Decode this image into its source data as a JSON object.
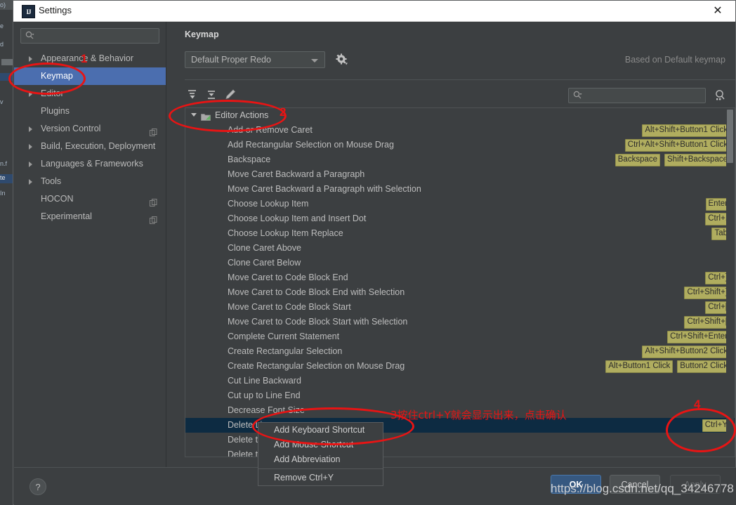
{
  "window": {
    "title": "Settings",
    "app_icon": "intellij-idea-icon",
    "close_label": "✕"
  },
  "sidebar": {
    "search": {
      "placeholder": "",
      "icon": "search-icon"
    },
    "items": [
      {
        "label": "Appearance & Behavior",
        "expandable": true,
        "selected": false,
        "badge": false
      },
      {
        "label": "Keymap",
        "expandable": false,
        "selected": true,
        "badge": false
      },
      {
        "label": "Editor",
        "expandable": true,
        "selected": false,
        "badge": false
      },
      {
        "label": "Plugins",
        "expandable": false,
        "selected": false,
        "badge": false
      },
      {
        "label": "Version Control",
        "expandable": true,
        "selected": false,
        "badge": true
      },
      {
        "label": "Build, Execution, Deployment",
        "expandable": true,
        "selected": false,
        "badge": false
      },
      {
        "label": "Languages & Frameworks",
        "expandable": true,
        "selected": false,
        "badge": false
      },
      {
        "label": "Tools",
        "expandable": true,
        "selected": false,
        "badge": false
      },
      {
        "label": "HOCON",
        "expandable": false,
        "selected": false,
        "badge": true
      },
      {
        "label": "Experimental",
        "expandable": false,
        "selected": false,
        "badge": true
      }
    ]
  },
  "panel": {
    "title": "Keymap",
    "keymap_selected": "Default Proper Redo",
    "gear_icon": "gear-icon",
    "based_on": "Based on Default keymap",
    "toolbar": {
      "expand_all_icon": "expand-all-icon",
      "collapse_all_icon": "collapse-all-icon",
      "edit_icon": "edit-pencil-icon",
      "search_placeholder": "",
      "search_icon": "search-icon",
      "find_shortcut_icon": "find-by-shortcut-icon"
    }
  },
  "action_tree": {
    "group": {
      "label": "Editor Actions",
      "icon": "folder-editor-icon",
      "expanded": true
    },
    "rows": [
      {
        "label": "Add or Remove Caret",
        "shortcuts": [
          "Alt+Shift+Button1 Click"
        ],
        "selected": false
      },
      {
        "label": "Add Rectangular Selection on Mouse Drag",
        "shortcuts": [
          "Ctrl+Alt+Shift+Button1 Click"
        ],
        "selected": false
      },
      {
        "label": "Backspace",
        "shortcuts": [
          "Backspace",
          "Shift+Backspace"
        ],
        "selected": false
      },
      {
        "label": "Move Caret Backward a Paragraph",
        "shortcuts": [],
        "selected": false
      },
      {
        "label": "Move Caret Backward a Paragraph with Selection",
        "shortcuts": [],
        "selected": false
      },
      {
        "label": "Choose Lookup Item",
        "shortcuts": [
          "Enter"
        ],
        "selected": false
      },
      {
        "label": "Choose Lookup Item and Insert Dot",
        "shortcuts": [
          "Ctrl+."
        ],
        "selected": false
      },
      {
        "label": "Choose Lookup Item Replace",
        "shortcuts": [
          "Tab"
        ],
        "selected": false
      },
      {
        "label": "Clone Caret Above",
        "shortcuts": [],
        "selected": false
      },
      {
        "label": "Clone Caret Below",
        "shortcuts": [],
        "selected": false
      },
      {
        "label": "Move Caret to Code Block End",
        "shortcuts": [
          "Ctrl+]"
        ],
        "selected": false
      },
      {
        "label": "Move Caret to Code Block End with Selection",
        "shortcuts": [
          "Ctrl+Shift+]"
        ],
        "selected": false
      },
      {
        "label": "Move Caret to Code Block Start",
        "shortcuts": [
          "Ctrl+["
        ],
        "selected": false
      },
      {
        "label": "Move Caret to Code Block Start with Selection",
        "shortcuts": [
          "Ctrl+Shift+["
        ],
        "selected": false
      },
      {
        "label": "Complete Current Statement",
        "shortcuts": [
          "Ctrl+Shift+Enter"
        ],
        "selected": false
      },
      {
        "label": "Create Rectangular Selection",
        "shortcuts": [
          "Alt+Shift+Button2 Click"
        ],
        "selected": false
      },
      {
        "label": "Create Rectangular Selection on Mouse Drag",
        "shortcuts": [
          "Alt+Button1 Click",
          "Button2 Click"
        ],
        "selected": false
      },
      {
        "label": "Cut Line Backward",
        "shortcuts": [],
        "selected": false
      },
      {
        "label": "Cut up to Line End",
        "shortcuts": [],
        "selected": false
      },
      {
        "label": "Decrease Font Size",
        "shortcuts": [],
        "selected": false
      },
      {
        "label": "Delete Line",
        "shortcuts": [
          "Ctrl+Y"
        ],
        "selected": true
      },
      {
        "label": "Delete to Line End",
        "shortcuts": [],
        "selected": false
      },
      {
        "label": "Delete to Line Start",
        "shortcuts": [],
        "selected": false
      }
    ]
  },
  "context_menu": {
    "items": [
      {
        "label": "Add Keyboard Shortcut",
        "separator_after": false
      },
      {
        "label": "Add Mouse Shortcut",
        "separator_after": false
      },
      {
        "label": "Add Abbreviation",
        "separator_after": true
      },
      {
        "label": "Remove Ctrl+Y",
        "separator_after": false
      }
    ]
  },
  "bottom_bar": {
    "help_label": "?",
    "ok_label": "OK",
    "cancel_label": "Cancel",
    "apply_label": "Apply"
  },
  "annotations": {
    "marker_1": "1",
    "marker_2": "2",
    "marker_3": "3按住ctrl+Y就会显示出来，点击确认",
    "marker_4": "4",
    "accent_color": "#e81414"
  },
  "watermark": {
    "url": "https://blog.csdn.net/qq_34246778",
    "sub": ""
  }
}
